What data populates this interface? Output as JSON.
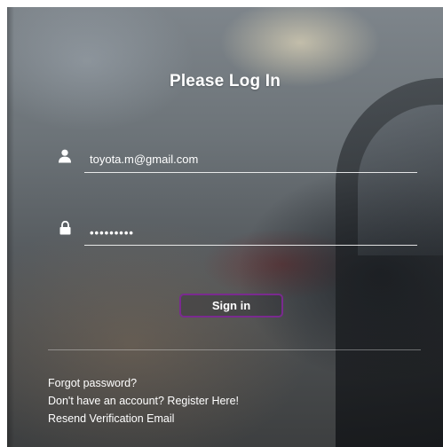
{
  "login": {
    "title": "Please Log In",
    "email_value": "toyota.m@gmail.com",
    "password_value": "•••••••••",
    "signin_label": "Sign in"
  },
  "links": {
    "forgot_password": "Forgot password?",
    "register": "Don't have an account? Register Here!",
    "resend_verification": "Resend Verification Email"
  },
  "icons": {
    "email": "user-icon",
    "password": "lock-icon"
  },
  "colors": {
    "button_border": "#7a2a8f",
    "text": "#ffffff"
  }
}
